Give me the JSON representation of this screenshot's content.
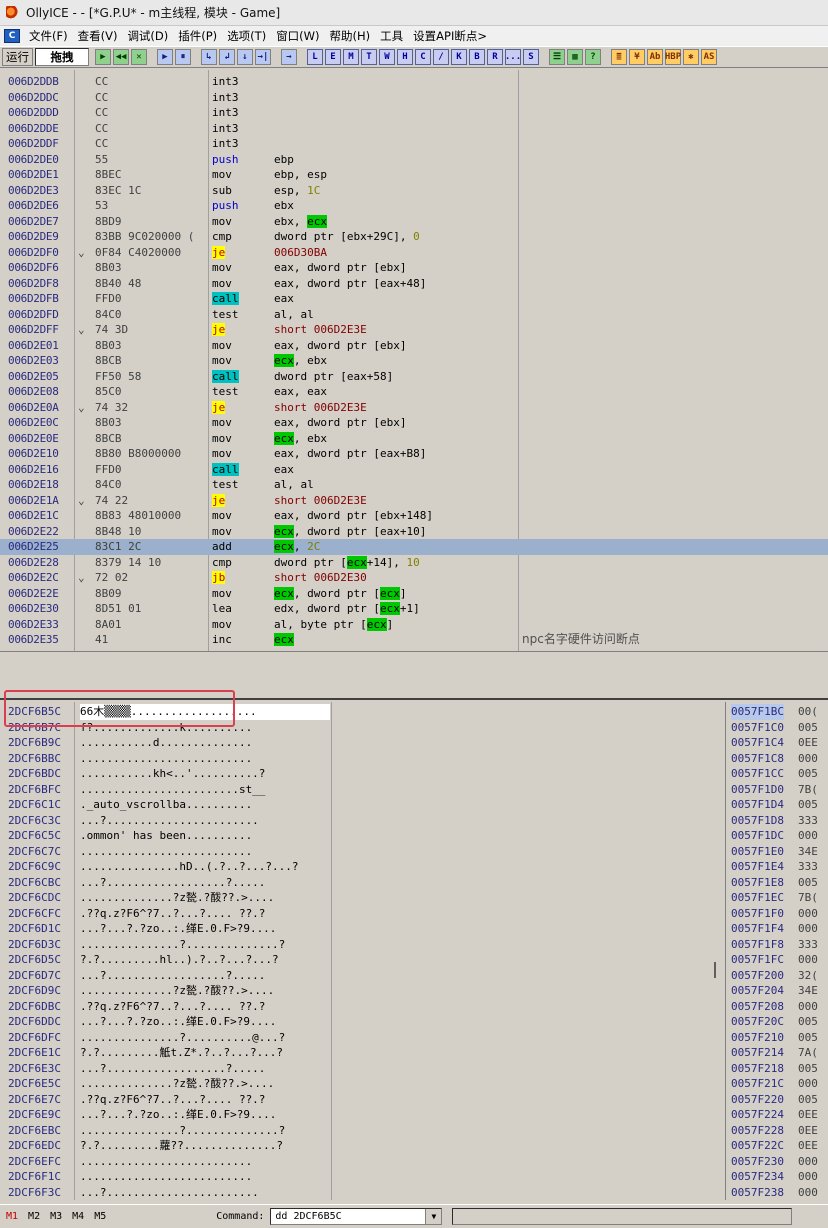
{
  "window": {
    "title": "OllyICE - - [*G.P.U* - m主线程, 模块 - Game]"
  },
  "menu": {
    "items": [
      "文件(F)",
      "查看(V)",
      "调试(D)",
      "插件(P)",
      "选项(T)",
      "窗口(W)",
      "帮助(H)",
      "工具",
      "设置API断点>"
    ]
  },
  "toolbar": {
    "status_label": "运行",
    "status_value": "拖拽",
    "buttons_group1": [
      "▶",
      "◀◀",
      "✕"
    ],
    "buttons_group2": [
      "▶",
      "⏸"
    ],
    "buttons_group3": [
      "↳",
      "↲",
      "↓",
      "→|"
    ],
    "buttons_group4": [
      "→"
    ],
    "letters": [
      "L",
      "E",
      "M",
      "T",
      "W",
      "H",
      "C",
      "/",
      "K",
      "B",
      "R",
      "...",
      "S"
    ],
    "buttons_group5": [
      "☰",
      "▦",
      "?"
    ],
    "buttons_group6": [
      "≣",
      "¥",
      "Ab",
      "HBP",
      "✱",
      "AS"
    ]
  },
  "cpu": {
    "rows": [
      {
        "addr": "006D2DDB",
        "arrow": "",
        "hex": "CC",
        "mnem": "int3",
        "mtype": "",
        "ops": []
      },
      {
        "addr": "006D2DDC",
        "arrow": "",
        "hex": "CC",
        "mnem": "int3",
        "mtype": "",
        "ops": []
      },
      {
        "addr": "006D2DDD",
        "arrow": "",
        "hex": "CC",
        "mnem": "int3",
        "mtype": "",
        "ops": []
      },
      {
        "addr": "006D2DDE",
        "arrow": "",
        "hex": "CC",
        "mnem": "int3",
        "mtype": "",
        "ops": []
      },
      {
        "addr": "006D2DDF",
        "arrow": "",
        "hex": "CC",
        "mnem": "int3",
        "mtype": "",
        "ops": []
      },
      {
        "addr": "006D2DE0",
        "arrow": "",
        "hex": "55",
        "mnem": "push",
        "mtype": "push",
        "ops": [
          {
            "t": "ebp",
            "c": ""
          }
        ]
      },
      {
        "addr": "006D2DE1",
        "arrow": "",
        "hex": "8BEC",
        "mnem": "mov",
        "mtype": "",
        "ops": [
          {
            "t": "ebp, esp",
            "c": ""
          }
        ]
      },
      {
        "addr": "006D2DE3",
        "arrow": "",
        "hex": "83EC 1C",
        "mnem": "sub",
        "mtype": "",
        "ops": [
          {
            "t": "esp, ",
            "c": ""
          },
          {
            "t": "1C",
            "c": "num"
          }
        ]
      },
      {
        "addr": "006D2DE6",
        "arrow": "",
        "hex": "53",
        "mnem": "push",
        "mtype": "push",
        "ops": [
          {
            "t": "ebx",
            "c": ""
          }
        ]
      },
      {
        "addr": "006D2DE7",
        "arrow": "",
        "hex": "8BD9",
        "mnem": "mov",
        "mtype": "",
        "ops": [
          {
            "t": "ebx, ",
            "c": ""
          },
          {
            "t": "ecx",
            "c": "ecx"
          }
        ]
      },
      {
        "addr": "006D2DE9",
        "arrow": "",
        "hex": "83BB 9C020000 (",
        "mnem": "cmp",
        "mtype": "",
        "ops": [
          {
            "t": "dword ptr [ebx+29C], ",
            "c": ""
          },
          {
            "t": "0",
            "c": "num"
          }
        ]
      },
      {
        "addr": "006D2DF0",
        "arrow": "⌄",
        "hex": "0F84 C4020000",
        "mnem": "je",
        "mtype": "jmp",
        "ops": [
          {
            "t": "006D30BA",
            "c": "jt"
          }
        ]
      },
      {
        "addr": "006D2DF6",
        "arrow": "",
        "hex": "8B03",
        "mnem": "mov",
        "mtype": "",
        "ops": [
          {
            "t": "eax, dword ptr [ebx]",
            "c": ""
          }
        ]
      },
      {
        "addr": "006D2DF8",
        "arrow": "",
        "hex": "8B40 48",
        "mnem": "mov",
        "mtype": "",
        "ops": [
          {
            "t": "eax, dword ptr [eax+48]",
            "c": ""
          }
        ]
      },
      {
        "addr": "006D2DFB",
        "arrow": "",
        "hex": "FFD0",
        "mnem": "call",
        "mtype": "call",
        "ops": [
          {
            "t": "eax",
            "c": ""
          }
        ]
      },
      {
        "addr": "006D2DFD",
        "arrow": "",
        "hex": "84C0",
        "mnem": "test",
        "mtype": "",
        "ops": [
          {
            "t": "al, al",
            "c": ""
          }
        ]
      },
      {
        "addr": "006D2DFF",
        "arrow": "⌄",
        "hex": "74 3D",
        "mnem": "je",
        "mtype": "jmp",
        "ops": [
          {
            "t": "short 006D2E3E",
            "c": "jt"
          }
        ]
      },
      {
        "addr": "006D2E01",
        "arrow": "",
        "hex": "8B03",
        "mnem": "mov",
        "mtype": "",
        "ops": [
          {
            "t": "eax, dword ptr [ebx]",
            "c": ""
          }
        ]
      },
      {
        "addr": "006D2E03",
        "arrow": "",
        "hex": "8BCB",
        "mnem": "mov",
        "mtype": "",
        "ops": [
          {
            "t": "ecx",
            "c": "ecx"
          },
          {
            "t": ", ebx",
            "c": ""
          }
        ]
      },
      {
        "addr": "006D2E05",
        "arrow": "",
        "hex": "FF50 58",
        "mnem": "call",
        "mtype": "call",
        "ops": [
          {
            "t": "dword ptr [eax+58]",
            "c": ""
          }
        ]
      },
      {
        "addr": "006D2E08",
        "arrow": "",
        "hex": "85C0",
        "mnem": "test",
        "mtype": "",
        "ops": [
          {
            "t": "eax, eax",
            "c": ""
          }
        ]
      },
      {
        "addr": "006D2E0A",
        "arrow": "⌄",
        "hex": "74 32",
        "mnem": "je",
        "mtype": "jmp",
        "ops": [
          {
            "t": "short 006D2E3E",
            "c": "jt"
          }
        ]
      },
      {
        "addr": "006D2E0C",
        "arrow": "",
        "hex": "8B03",
        "mnem": "mov",
        "mtype": "",
        "ops": [
          {
            "t": "eax, dword ptr [ebx]",
            "c": ""
          }
        ]
      },
      {
        "addr": "006D2E0E",
        "arrow": "",
        "hex": "8BCB",
        "mnem": "mov",
        "mtype": "",
        "ops": [
          {
            "t": "ecx",
            "c": "ecx"
          },
          {
            "t": ", ebx",
            "c": ""
          }
        ]
      },
      {
        "addr": "006D2E10",
        "arrow": "",
        "hex": "8B80 B8000000",
        "mnem": "mov",
        "mtype": "",
        "ops": [
          {
            "t": "eax, dword ptr [eax+B8]",
            "c": ""
          }
        ]
      },
      {
        "addr": "006D2E16",
        "arrow": "",
        "hex": "FFD0",
        "mnem": "call",
        "mtype": "call",
        "ops": [
          {
            "t": "eax",
            "c": ""
          }
        ]
      },
      {
        "addr": "006D2E18",
        "arrow": "",
        "hex": "84C0",
        "mnem": "test",
        "mtype": "",
        "ops": [
          {
            "t": "al, al",
            "c": ""
          }
        ]
      },
      {
        "addr": "006D2E1A",
        "arrow": "⌄",
        "hex": "74 22",
        "mnem": "je",
        "mtype": "jmp",
        "ops": [
          {
            "t": "short 006D2E3E",
            "c": "jt"
          }
        ]
      },
      {
        "addr": "006D2E1C",
        "arrow": "",
        "hex": "8B83 48010000",
        "mnem": "mov",
        "mtype": "",
        "ops": [
          {
            "t": "eax, dword ptr [ebx+148]",
            "c": ""
          }
        ]
      },
      {
        "addr": "006D2E22",
        "arrow": "",
        "hex": "8B48 10",
        "mnem": "mov",
        "mtype": "",
        "ops": [
          {
            "t": "ecx",
            "c": "ecx"
          },
          {
            "t": ", dword ptr [eax+10]",
            "c": ""
          }
        ]
      },
      {
        "addr": "006D2E25",
        "arrow": "",
        "hex": "83C1 2C",
        "mnem": "add",
        "mtype": "",
        "selected": true,
        "ops": [
          {
            "t": "ecx",
            "c": "ecx"
          },
          {
            "t": ", ",
            "c": ""
          },
          {
            "t": "2C",
            "c": "num"
          }
        ]
      },
      {
        "addr": "006D2E28",
        "arrow": "",
        "hex": "8379 14 10",
        "mnem": "cmp",
        "mtype": "",
        "ops": [
          {
            "t": "dword ptr [",
            "c": ""
          },
          {
            "t": "ecx",
            "c": "ecx"
          },
          {
            "t": "+14], ",
            "c": ""
          },
          {
            "t": "10",
            "c": "num"
          }
        ]
      },
      {
        "addr": "006D2E2C",
        "arrow": "⌄",
        "hex": "72 02",
        "mnem": "jb",
        "mtype": "jmp",
        "ops": [
          {
            "t": "short 006D2E30",
            "c": "jt"
          }
        ]
      },
      {
        "addr": "006D2E2E",
        "arrow": "",
        "hex": "8B09",
        "mnem": "mov",
        "mtype": "",
        "ops": [
          {
            "t": "ecx",
            "c": "ecx"
          },
          {
            "t": ", dword ptr [",
            "c": ""
          },
          {
            "t": "ecx",
            "c": "ecx"
          },
          {
            "t": "]",
            "c": ""
          }
        ]
      },
      {
        "addr": "006D2E30",
        "arrow": "",
        "hex": "8D51 01",
        "mnem": "lea",
        "mtype": "",
        "ops": [
          {
            "t": "edx, dword ptr [",
            "c": ""
          },
          {
            "t": "ecx",
            "c": "ecx"
          },
          {
            "t": "+1]",
            "c": ""
          }
        ]
      },
      {
        "addr": "006D2E33",
        "arrow": "",
        "hex": "8A01",
        "mnem": "mov",
        "mtype": "",
        "ops": [
          {
            "t": "al, byte ptr [",
            "c": ""
          },
          {
            "t": "ecx",
            "c": "ecx"
          },
          {
            "t": "]",
            "c": ""
          }
        ]
      },
      {
        "addr": "006D2E35",
        "arrow": "",
        "hex": "41",
        "mnem": "inc",
        "mtype": "",
        "comment": "npc名字硬件访问断点",
        "ops": [
          {
            "t": "ecx",
            "c": "ecx"
          }
        ]
      }
    ]
  },
  "dump": {
    "rows": [
      {
        "addr": "2DCF6B5C",
        "text": "66木▒▒▒▒..................."
      },
      {
        "addr": "2DCF6B7C",
        "text": "f?.............k.........."
      },
      {
        "addr": "2DCF6B9C",
        "text": "...........d.............."
      },
      {
        "addr": "2DCF6BBC",
        "text": ".........................."
      },
      {
        "addr": "2DCF6BDC",
        "text": "...........kh<..'..........?"
      },
      {
        "addr": "2DCF6BFC",
        "text": "........................st__"
      },
      {
        "addr": "2DCF6C1C",
        "text": "._auto_vscrollba.........."
      },
      {
        "addr": "2DCF6C3C",
        "text": "...?......................."
      },
      {
        "addr": "2DCF6C5C",
        "text": ".ommon' has been.........."
      },
      {
        "addr": "2DCF6C7C",
        "text": ".........................."
      },
      {
        "addr": "2DCF6C9C",
        "text": "...............hD..(.?..?...?...?"
      },
      {
        "addr": "2DCF6CBC",
        "text": "...?..................?....."
      },
      {
        "addr": "2DCF6CDC",
        "text": "..............?z甃.?酦??.>...."
      },
      {
        "addr": "2DCF6CFC",
        "text": ".??q.z?F6^?7..?...?....  ??.?"
      },
      {
        "addr": "2DCF6D1C",
        "text": "...?...?.?zo..:.缂E.0.F>?9...."
      },
      {
        "addr": "2DCF6D3C",
        "text": "...............?..............?"
      },
      {
        "addr": "2DCF6D5C",
        "text": "?.?.........hl..).?..?...?...?"
      },
      {
        "addr": "2DCF6D7C",
        "text": "...?..................?....."
      },
      {
        "addr": "2DCF6D9C",
        "text": "..............?z甃.?酦??.>...."
      },
      {
        "addr": "2DCF6DBC",
        "text": ".??q.z?F6^?7..?...?....  ??.?"
      },
      {
        "addr": "2DCF6DDC",
        "text": "...?...?.?zo..:.缂E.0.F>?9...."
      },
      {
        "addr": "2DCF6DFC",
        "text": "...............?..........@...?"
      },
      {
        "addr": "2DCF6E1C",
        "text": "?.?.........觝t.Z*.?..?...?...?"
      },
      {
        "addr": "2DCF6E3C",
        "text": "...?..................?....."
      },
      {
        "addr": "2DCF6E5C",
        "text": "..............?z甃.?酦??.>...."
      },
      {
        "addr": "2DCF6E7C",
        "text": ".??q.z?F6^?7..?...?....  ??.?"
      },
      {
        "addr": "2DCF6E9C",
        "text": "...?...?.?zo..:.缂E.0.F>?9...."
      },
      {
        "addr": "2DCF6EBC",
        "text": "...............?..............?"
      },
      {
        "addr": "2DCF6EDC",
        "text": "?.?.........蘿??..............?"
      },
      {
        "addr": "2DCF6EFC",
        "text": ".........................."
      },
      {
        "addr": "2DCF6F1C",
        "text": ".........................."
      },
      {
        "addr": "2DCF6F3C",
        "text": "...?......................."
      }
    ]
  },
  "stack": {
    "rows": [
      {
        "addr": "0057F1BC",
        "val": "00("
      },
      {
        "addr": "0057F1C0",
        "val": "005"
      },
      {
        "addr": "0057F1C4",
        "val": "0EE"
      },
      {
        "addr": "0057F1C8",
        "val": "000"
      },
      {
        "addr": "0057F1CC",
        "val": "005"
      },
      {
        "addr": "0057F1D0",
        "val": "7B("
      },
      {
        "addr": "0057F1D4",
        "val": "005"
      },
      {
        "addr": "0057F1D8",
        "val": "333"
      },
      {
        "addr": "0057F1DC",
        "val": "000"
      },
      {
        "addr": "0057F1E0",
        "val": "34E"
      },
      {
        "addr": "0057F1E4",
        "val": "333"
      },
      {
        "addr": "0057F1E8",
        "val": "005"
      },
      {
        "addr": "0057F1EC",
        "val": "7B("
      },
      {
        "addr": "0057F1F0",
        "val": "000"
      },
      {
        "addr": "0057F1F4",
        "val": "000"
      },
      {
        "addr": "0057F1F8",
        "val": "333"
      },
      {
        "addr": "0057F1FC",
        "val": "000"
      },
      {
        "addr": "0057F200",
        "val": "32("
      },
      {
        "addr": "0057F204",
        "val": "34E"
      },
      {
        "addr": "0057F208",
        "val": "000"
      },
      {
        "addr": "0057F20C",
        "val": "005"
      },
      {
        "addr": "0057F210",
        "val": "005"
      },
      {
        "addr": "0057F214",
        "val": "7A("
      },
      {
        "addr": "0057F218",
        "val": "005"
      },
      {
        "addr": "0057F21C",
        "val": "000"
      },
      {
        "addr": "0057F220",
        "val": "005"
      },
      {
        "addr": "0057F224",
        "val": "0EE"
      },
      {
        "addr": "0057F228",
        "val": "0EE"
      },
      {
        "addr": "0057F22C",
        "val": "0EE"
      },
      {
        "addr": "0057F230",
        "val": "000"
      },
      {
        "addr": "0057F234",
        "val": "000"
      },
      {
        "addr": "0057F238",
        "val": "000"
      }
    ]
  },
  "bottombar": {
    "tabs": [
      "M1",
      "M2",
      "M3",
      "M4",
      "M5"
    ],
    "command_label": "Command:",
    "command_value": "dd 2DCF6B5C"
  }
}
